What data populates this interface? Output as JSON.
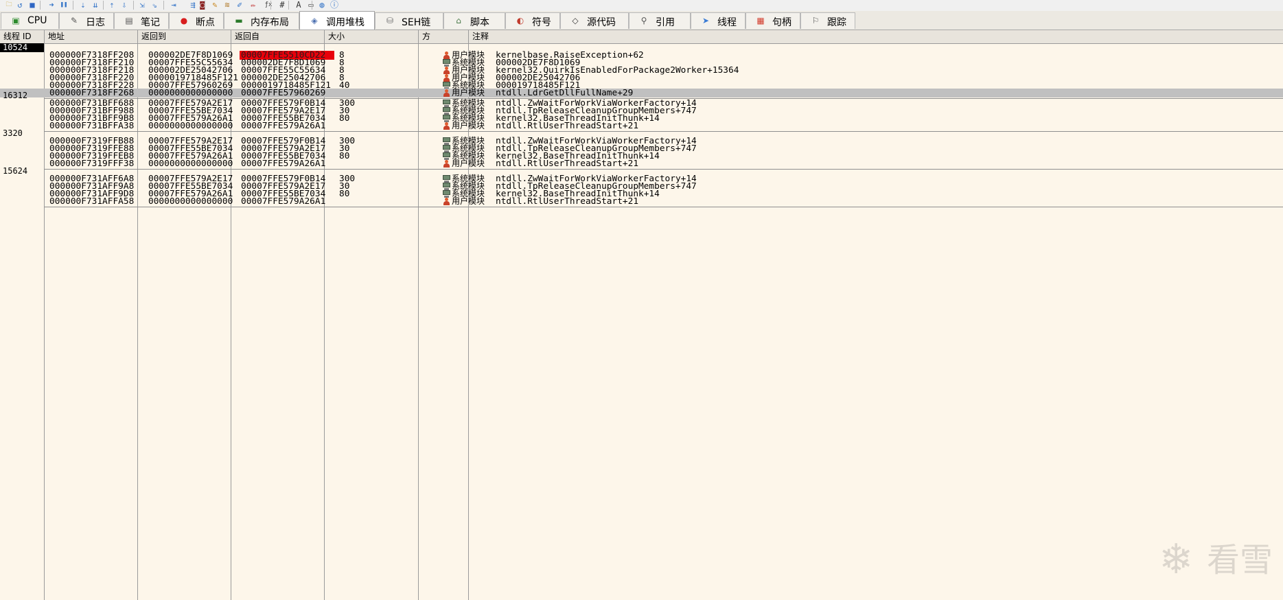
{
  "toolbar": {
    "icons": [
      "open-icon",
      "restart-icon",
      "stop-icon",
      "run-icon",
      "pause-icon",
      "step-into-icon",
      "step-over-icon",
      "execute-till-return-icon",
      "run-to-user-code-icon",
      "trace-into-icon",
      "trace-over-icon",
      "step-icon",
      "animate-icon",
      "scylla-icon",
      "patch-icon",
      "comment-icon",
      "label-icon",
      "bookmark-icon",
      "function-icon",
      "hash-icon",
      "font-icon",
      "calculator-icon",
      "screenshot-icon",
      "about-icon"
    ],
    "glyphs": {
      "fx": "ƒx",
      "hash": "#",
      "font": "Aᵢ"
    }
  },
  "tabs": [
    {
      "label": "CPU",
      "icon": "cpu-icon",
      "glyph": "▣",
      "color": "#2c8a2c"
    },
    {
      "label": "日志",
      "icon": "log-icon",
      "glyph": "✎",
      "color": "#555555"
    },
    {
      "label": "笔记",
      "icon": "notes-icon",
      "glyph": "▤",
      "color": "#555555"
    },
    {
      "label": "断点",
      "icon": "breakpoint-icon",
      "glyph": "●",
      "color": "#d81e1e"
    },
    {
      "label": "内存布局",
      "icon": "memory-map-icon",
      "glyph": "▬",
      "color": "#2b7a2b"
    },
    {
      "label": "调用堆栈",
      "icon": "call-stack-icon",
      "glyph": "◈",
      "color": "#4b6fb0"
    },
    {
      "label": "SEH链",
      "icon": "seh-chain-icon",
      "glyph": "⛁",
      "color": "#6a6a6a"
    },
    {
      "label": "脚本",
      "icon": "script-icon",
      "glyph": "⌂",
      "color": "#4a7a4a"
    },
    {
      "label": "符号",
      "icon": "symbols-icon",
      "glyph": "◐",
      "color": "#c0392b"
    },
    {
      "label": "源代码",
      "icon": "source-icon",
      "glyph": "◇",
      "color": "#333333"
    },
    {
      "label": "引用",
      "icon": "references-icon",
      "glyph": "⚲",
      "color": "#555555"
    },
    {
      "label": "线程",
      "icon": "threads-icon",
      "glyph": "➤",
      "color": "#3a7bd5"
    },
    {
      "label": "句柄",
      "icon": "handles-icon",
      "glyph": "▦",
      "color": "#d23a2a"
    },
    {
      "label": "跟踪",
      "icon": "trace-icon",
      "glyph": "⚐",
      "color": "#555555"
    }
  ],
  "active_tab": "调用堆栈",
  "columns": [
    "线程 ID",
    "地址",
    "返回到",
    "返回自",
    "大小",
    "方",
    "注释"
  ],
  "threads": [
    {
      "id": "10524",
      "selected": true,
      "frames": [
        {
          "address": "000000F7318FF208",
          "to": "000002DE7F8D1069",
          "from": "00007FFE5510CD22",
          "size": "8",
          "module": "用户模块",
          "mod_type": "user",
          "comment": "kernelbase.RaiseException+62",
          "from_breakpoint": true
        },
        {
          "address": "000000F7318FF210",
          "to": "00007FFE55C55634",
          "from": "000002DE7F8D1069",
          "size": "8",
          "module": "系统模块",
          "mod_type": "sys",
          "comment": "000002DE7F8D1069"
        },
        {
          "address": "000000F7318FF218",
          "to": "000002DE25042706",
          "from": "00007FFE55C55634",
          "size": "8",
          "module": "用户模块",
          "mod_type": "user",
          "comment": "kernel32.QuirkIsEnabledForPackage2Worker+15364"
        },
        {
          "address": "000000F7318FF220",
          "to": "0000019718485F121",
          "from": "000002DE25042706",
          "size": "8",
          "module": "用户模块",
          "mod_type": "user",
          "comment": "000002DE25042706"
        },
        {
          "address": "000000F7318FF228",
          "to": "00007FFE57960269",
          "from": "0000019718485F121",
          "size": "40",
          "module": "系统模块",
          "mod_type": "sys",
          "comment": "000019718485F121"
        },
        {
          "address": "000000F7318FF268",
          "to": "0000000000000000",
          "from": "00007FFE57960269",
          "size": "",
          "module": "用户模块",
          "mod_type": "user",
          "comment": "ntdll.LdrGetDllFullName+29",
          "highlight": true
        }
      ]
    },
    {
      "id": "16312",
      "frames": [
        {
          "address": "000000F731BFF688",
          "to": "00007FFE579A2E17",
          "from": "00007FFE579F0B14",
          "size": "300",
          "module": "系统模块",
          "mod_type": "sys",
          "comment": "ntdll.ZwWaitForWorkViaWorkerFactory+14"
        },
        {
          "address": "000000F731BFF988",
          "to": "00007FFE55BE7034",
          "from": "00007FFE579A2E17",
          "size": "30",
          "module": "系统模块",
          "mod_type": "sys",
          "comment": "ntdll.TpReleaseCleanupGroupMembers+747"
        },
        {
          "address": "000000F731BFF9B8",
          "to": "00007FFE579A26A1",
          "from": "00007FFE55BE7034",
          "size": "80",
          "module": "系统模块",
          "mod_type": "sys",
          "comment": "kernel32.BaseThreadInitThunk+14"
        },
        {
          "address": "000000F731BFFA38",
          "to": "0000000000000000",
          "from": "00007FFE579A26A1",
          "size": "",
          "module": "用户模块",
          "mod_type": "user",
          "comment": "ntdll.RtlUserThreadStart+21"
        }
      ]
    },
    {
      "id": "3320",
      "frames": [
        {
          "address": "000000F7319FFB88",
          "to": "00007FFE579A2E17",
          "from": "00007FFE579F0B14",
          "size": "300",
          "module": "系统模块",
          "mod_type": "sys",
          "comment": "ntdll.ZwWaitForWorkViaWorkerFactory+14"
        },
        {
          "address": "000000F7319FFE88",
          "to": "00007FFE55BE7034",
          "from": "00007FFE579A2E17",
          "size": "30",
          "module": "系统模块",
          "mod_type": "sys",
          "comment": "ntdll.TpReleaseCleanupGroupMembers+747"
        },
        {
          "address": "000000F7319FFEB8",
          "to": "00007FFE579A26A1",
          "from": "00007FFE55BE7034",
          "size": "80",
          "module": "系统模块",
          "mod_type": "sys",
          "comment": "kernel32.BaseThreadInitThunk+14"
        },
        {
          "address": "000000F7319FFF38",
          "to": "0000000000000000",
          "from": "00007FFE579A26A1",
          "size": "",
          "module": "用户模块",
          "mod_type": "user",
          "comment": "ntdll.RtlUserThreadStart+21"
        }
      ]
    },
    {
      "id": "15624",
      "frames": [
        {
          "address": "000000F731AFF6A8",
          "to": "00007FFE579A2E17",
          "from": "00007FFE579F0B14",
          "size": "300",
          "module": "系统模块",
          "mod_type": "sys",
          "comment": "ntdll.ZwWaitForWorkViaWorkerFactory+14"
        },
        {
          "address": "000000F731AFF9A8",
          "to": "00007FFE55BE7034",
          "from": "00007FFE579A2E17",
          "size": "30",
          "module": "系统模块",
          "mod_type": "sys",
          "comment": "ntdll.TpReleaseCleanupGroupMembers+747"
        },
        {
          "address": "000000F731AFF9D8",
          "to": "00007FFE579A26A1",
          "from": "00007FFE55BE7034",
          "size": "80",
          "module": "系统模块",
          "mod_type": "sys",
          "comment": "kernel32.BaseThreadInitThunk+14"
        },
        {
          "address": "000000F731AFFA58",
          "to": "0000000000000000",
          "from": "00007FFE579A26A1",
          "size": "",
          "module": "用户模块",
          "mod_type": "user",
          "comment": "ntdll.RtlUserThreadStart+21"
        }
      ]
    }
  ],
  "watermark": {
    "text": "看雪",
    "icon": "snowflake-logo-icon"
  },
  "colors": {
    "background": "#fdf6ea",
    "breakpoint": "#e8000b",
    "highlight_row": "#c0c0c0",
    "selected_thread": "#000000"
  }
}
